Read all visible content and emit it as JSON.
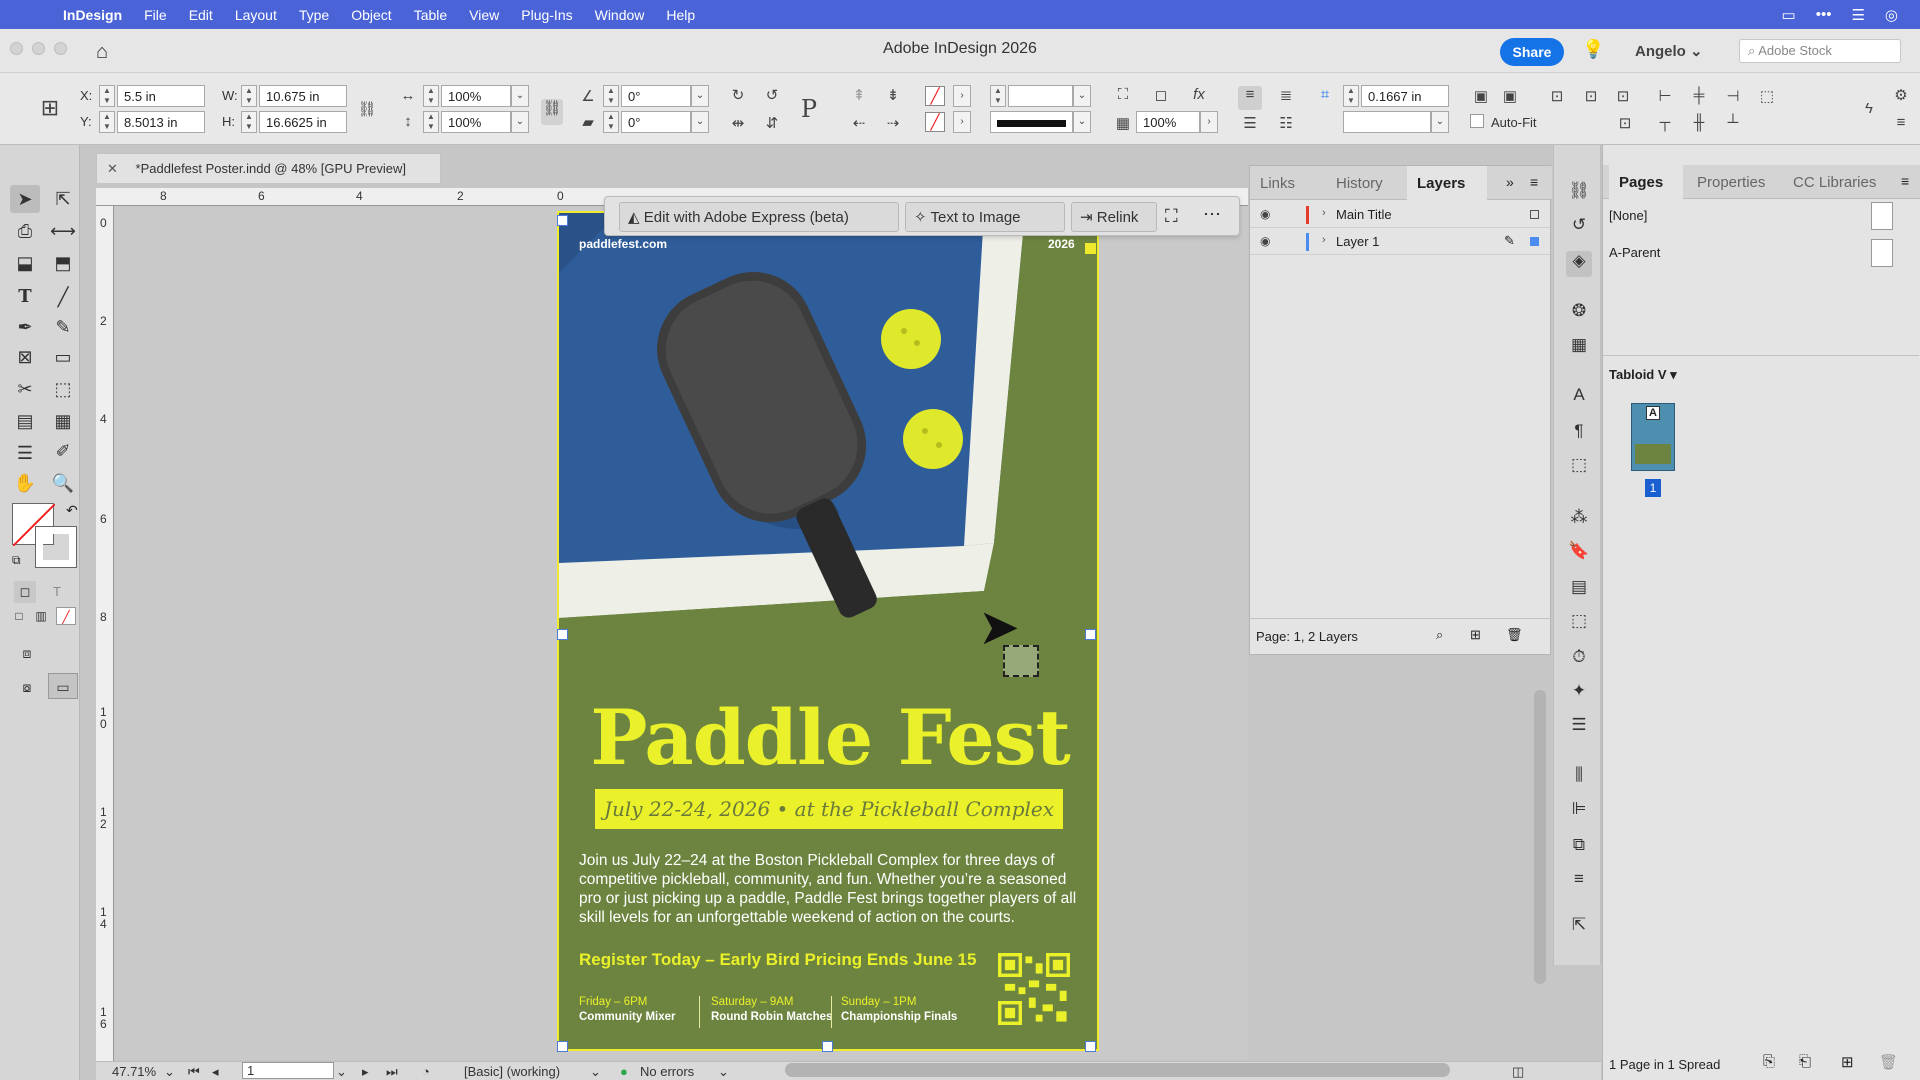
{
  "menubar": {
    "apple": "",
    "items": [
      "InDesign",
      "File",
      "Edit",
      "Layout",
      "Type",
      "Object",
      "Table",
      "View",
      "Plug-Ins",
      "Window",
      "Help"
    ]
  },
  "titlebar": {
    "title": "Adobe InDesign 2026",
    "share": "Share",
    "user": "Angelo",
    "stock_placeholder": "Adobe Stock"
  },
  "control": {
    "x_label": "X:",
    "x": "5.5 in",
    "y_label": "Y:",
    "y": "8.5013 in",
    "w_label": "W:",
    "w": "10.675 in",
    "h_label": "H:",
    "h": "16.6625 in",
    "scale_x": "100%",
    "scale_y": "100%",
    "rotate": "0°",
    "shear": "0°",
    "opacity": "100%",
    "gap": "0.1667 in",
    "autofit": "Auto-Fit"
  },
  "document": {
    "tab_title": "*Paddlefest Poster.indd @ 48% [GPU Preview]",
    "hruler": [
      "8",
      "6",
      "4",
      "2",
      "0"
    ],
    "vruler": [
      "0",
      "2",
      "4",
      "6",
      "8",
      "1\n0",
      "1\n2",
      "1\n4",
      "1\n6"
    ]
  },
  "context_bar": {
    "express": "Edit with Adobe Express (beta)",
    "text_to_image": "Text to Image",
    "relink": "Relink"
  },
  "poster": {
    "url": "paddlefest.com",
    "year": "2026",
    "title": "Paddle Fest",
    "dates": "July 22-24, 2026 • at the Pickleball Complex",
    "description": "Join us July 22–24 at the Boston Pickleball Complex for three days of competitive pickleball, community, and fun. Whether you’re a seasoned pro or just picking up a paddle, Paddle Fest brings together players of all skill levels for an unforgettable weekend of action on the courts.",
    "register": "Register Today – Early Bird Pricing Ends June 15",
    "schedule": [
      {
        "when": "Friday – 6PM",
        "what": "Community Mixer"
      },
      {
        "when": "Saturday – 9AM",
        "what": "Round Robin Matches"
      },
      {
        "when": "Sunday – 1PM",
        "what": "Championship Finals"
      }
    ],
    "colors": {
      "court_blue": "#2f5d9a",
      "grass": "#6c843f",
      "accent": "#eaf12b"
    }
  },
  "layers_panel": {
    "tabs": [
      "Links",
      "History",
      "Layers"
    ],
    "layers": [
      {
        "name": "Main Title",
        "color": "#e53b2f"
      },
      {
        "name": "Layer 1",
        "color": "#4a8cf0"
      }
    ],
    "status": "Page: 1, 2 Layers"
  },
  "pages_panel": {
    "tabs": [
      "Pages",
      "Properties",
      "CC Libraries"
    ],
    "masters": [
      "[None]",
      "A-Parent"
    ],
    "size": "Tabloid V",
    "page_number": "1",
    "master_letter": "A",
    "status": "1 Page in 1 Spread"
  },
  "statusbar": {
    "zoom": "47.71%",
    "page": "1",
    "style": "[Basic] (working)",
    "preflight": "No errors"
  }
}
